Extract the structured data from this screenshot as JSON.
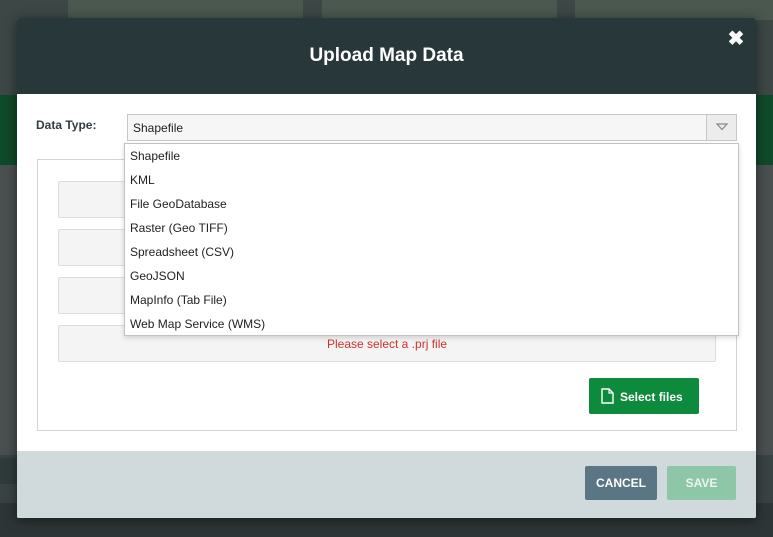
{
  "modal": {
    "title": "Upload Map Data",
    "close_symbol": "✖",
    "data_type_label": "Data Type:",
    "selected_value": "Shapefile",
    "options": [
      "Shapefile",
      "KML",
      "File GeoDatabase",
      "Raster (Geo TIFF)",
      "Spreadsheet (CSV)",
      "GeoJSON",
      "MapInfo (Tab File)",
      "Web Map Service (WMS)"
    ],
    "prj_message": "Please select a .prj file",
    "select_files_label": "Select files",
    "cancel_label": "CANCEL",
    "save_label": "SAVE"
  },
  "icons": {
    "close": "close-icon",
    "dropdown_arrow": "chevron-down-icon",
    "file": "file-icon"
  },
  "colors": {
    "header_bg": "#27373a",
    "primary_green": "#0e8a3c",
    "error_red": "#d0312d",
    "cancel_bg": "#5a7584",
    "save_disabled_bg": "#8dc7a7",
    "footer_bg": "#d0d9dc"
  }
}
